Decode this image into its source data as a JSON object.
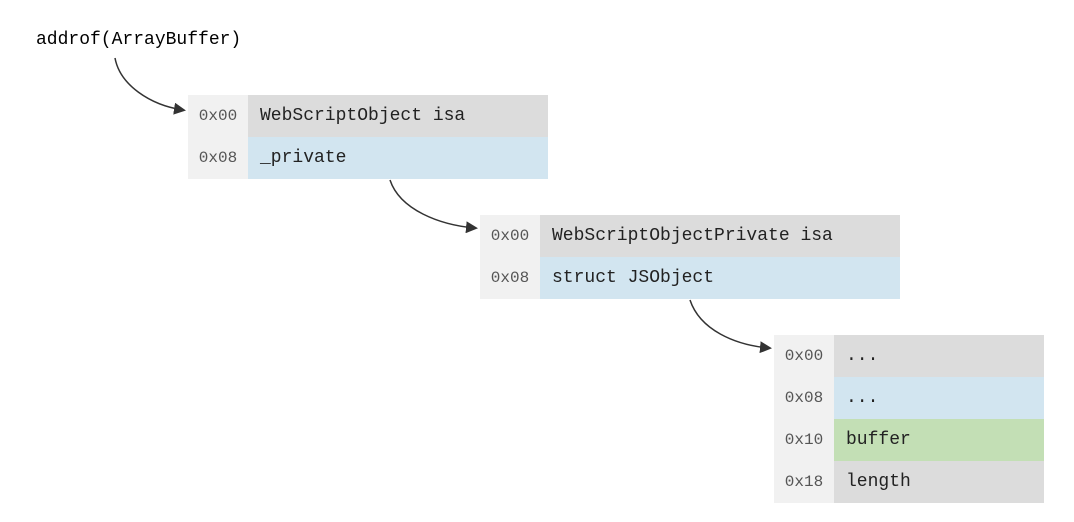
{
  "diagram": {
    "title": "addrof(ArrayBuffer)",
    "table1": {
      "rows": [
        {
          "offset": "0x00",
          "value": "WebScriptObject isa",
          "color": "gray"
        },
        {
          "offset": "0x08",
          "value": "_private",
          "color": "blue"
        }
      ]
    },
    "table2": {
      "rows": [
        {
          "offset": "0x00",
          "value": "WebScriptObjectPrivate isa",
          "color": "gray"
        },
        {
          "offset": "0x08",
          "value": "struct JSObject",
          "color": "blue"
        }
      ]
    },
    "table3": {
      "rows": [
        {
          "offset": "0x00",
          "value": "...",
          "color": "gray"
        },
        {
          "offset": "0x08",
          "value": "...",
          "color": "blue"
        },
        {
          "offset": "0x10",
          "value": "buffer",
          "color": "green"
        },
        {
          "offset": "0x18",
          "value": "length",
          "color": "gray"
        }
      ]
    }
  }
}
